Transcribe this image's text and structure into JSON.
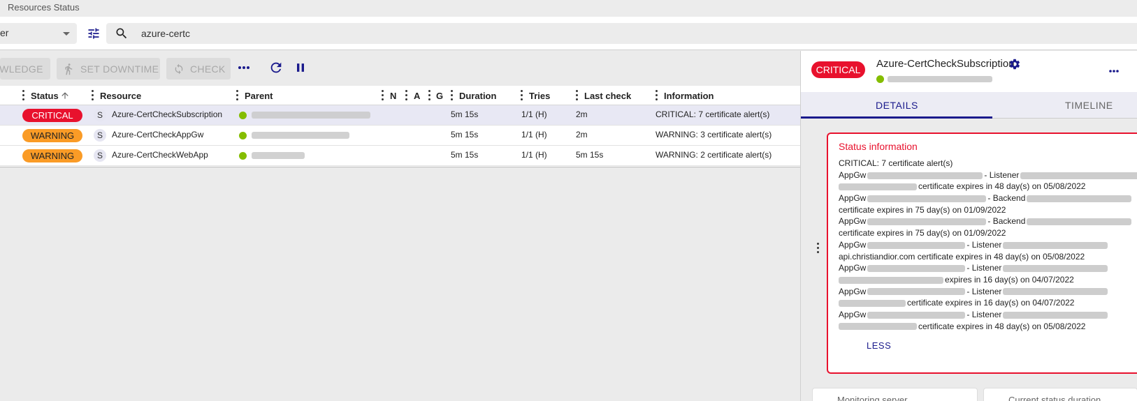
{
  "app": {
    "title": "Resources Status"
  },
  "filter": {
    "select_value": "er",
    "search_value": "azure-certc"
  },
  "toolbar": {
    "acknowledge_label": "ACKNOWLEDGE",
    "downtime_label": "SET DOWNTIME",
    "check_label": "CHECK"
  },
  "table": {
    "columns": {
      "status": "Status",
      "resource": "Resource",
      "parent": "Parent",
      "n": "N",
      "a": "A",
      "g": "G",
      "duration": "Duration",
      "tries": "Tries",
      "last_check": "Last check",
      "information": "Information"
    },
    "rows": [
      {
        "status": "CRITICAL",
        "type": "S",
        "resource": "Azure-CertCheckSubscription",
        "duration": "5m 15s",
        "tries": "1/1 (H)",
        "last_check": "2m",
        "information": "CRITICAL: 7 certificate alert(s)"
      },
      {
        "status": "WARNING",
        "type": "S",
        "resource": "Azure-CertCheckAppGw",
        "duration": "5m 15s",
        "tries": "1/1 (H)",
        "last_check": "2m",
        "information": "WARNING: 3 certificate alert(s)"
      },
      {
        "status": "WARNING",
        "type": "S",
        "resource": "Azure-CertCheckWebApp",
        "duration": "5m 15s",
        "tries": "1/1 (H)",
        "last_check": "5m 15s",
        "information": "WARNING: 2 certificate alert(s)"
      }
    ]
  },
  "details": {
    "status": "CRITICAL",
    "resource": "Azure-CertCheckSubscription",
    "tabs": {
      "details": "DETAILS",
      "timeline": "TIMELINE"
    },
    "card_title": "Status information",
    "lines": {
      "l0": "CRITICAL: 7 certificate alert(s)",
      "appgw": "AppGw",
      "listener": "- Listener",
      "backend": "- Backend",
      "exp48": "certificate expires in 48 day(s) on 05/08/2022",
      "exp75": "certificate expires in 75 day(s) on 01/09/2022",
      "api": "api.christiandior.com certificate expires in 48 day(s) on 05/08/2022",
      "exp16a": "expires in 16 day(s) on 04/07/2022",
      "exp16b": "certificate expires in 16 day(s) on 04/07/2022"
    },
    "less_label": "LESS",
    "monitoring_server": "Monitoring server",
    "current_status_duration": "Current status duration"
  },
  "colors": {
    "critical": "#e8112d",
    "warning": "#fa9b26",
    "ok": "#84bd00",
    "accent": "#1a1a8c"
  }
}
